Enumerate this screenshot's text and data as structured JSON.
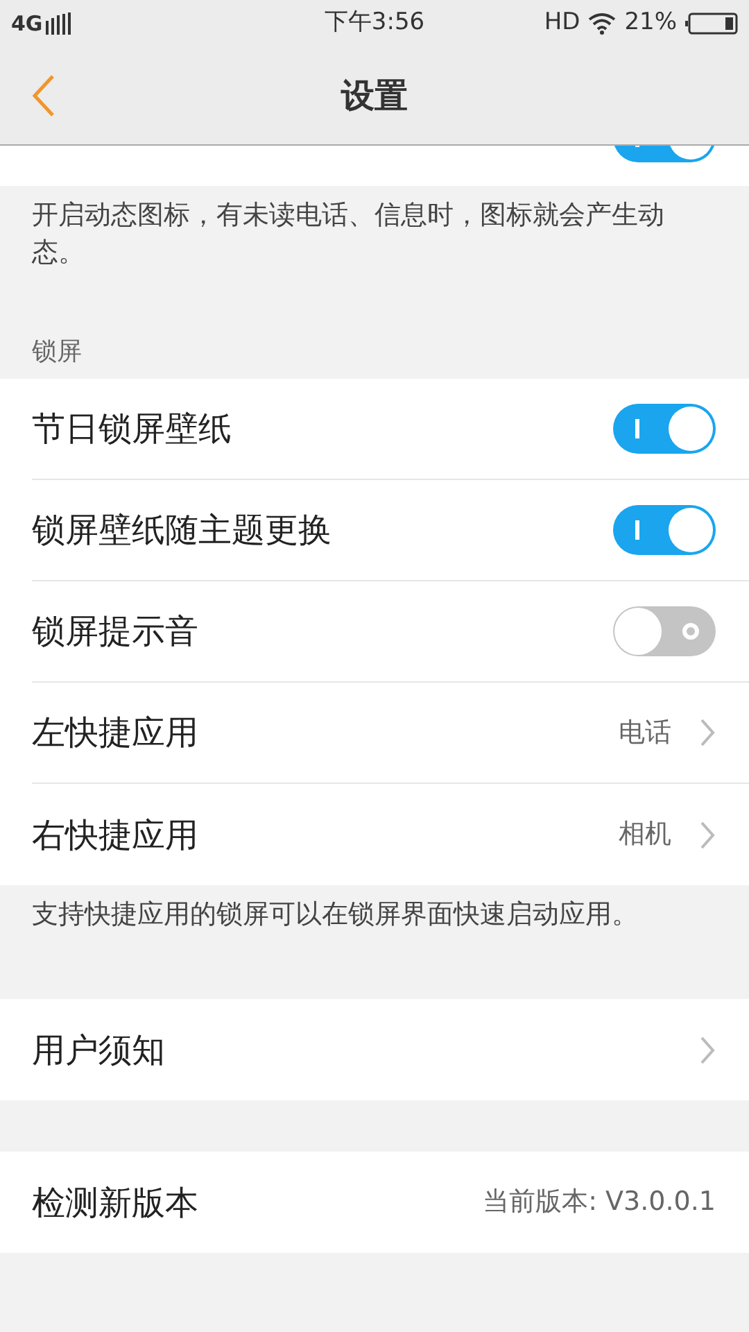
{
  "status_bar": {
    "network": "4G",
    "time": "下午3:56",
    "hd": "HD",
    "battery": "21%"
  },
  "header": {
    "title": "设置"
  },
  "partial_row": {
    "on": true
  },
  "groups": [
    {
      "note": "开启动态图标，有未读电话、信息时，图标就会产生动态。"
    },
    {
      "header": "锁屏",
      "rows": [
        {
          "kind": "toggle",
          "label": "节日锁屏壁纸",
          "on": true
        },
        {
          "kind": "toggle",
          "label": "锁屏壁纸随主题更换",
          "on": true
        },
        {
          "kind": "toggle",
          "label": "锁屏提示音",
          "on": false
        },
        {
          "kind": "link",
          "label": "左快捷应用",
          "value": "电话"
        },
        {
          "kind": "link",
          "label": "右快捷应用",
          "value": "相机"
        }
      ],
      "note": "支持快捷应用的锁屏可以在锁屏界面快速启动应用。"
    },
    {
      "rows": [
        {
          "kind": "link",
          "label": "用户须知"
        }
      ]
    },
    {
      "rows": [
        {
          "kind": "info",
          "label": "检测新版本",
          "value": "当前版本: V3.0.0.1"
        }
      ]
    }
  ]
}
